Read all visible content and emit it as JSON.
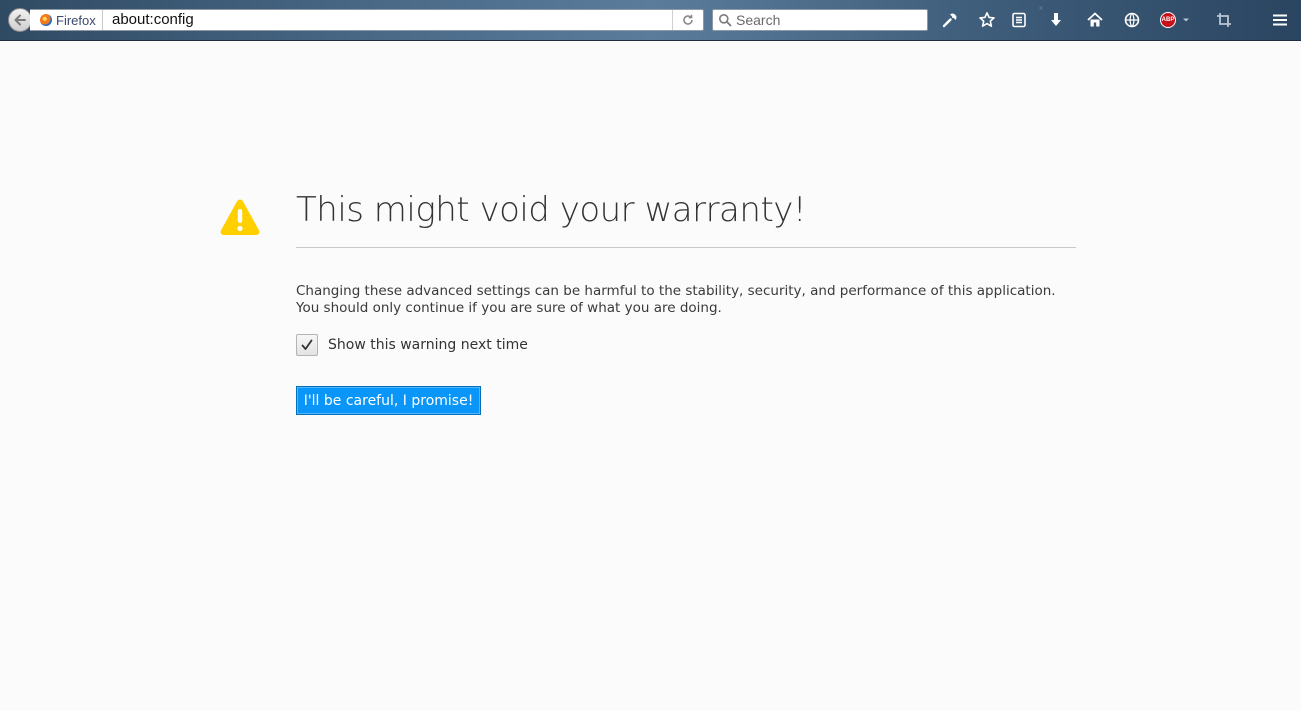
{
  "toolbar": {
    "identity_label": "Firefox",
    "url": "about:config",
    "search_placeholder": "Search",
    "abp_label": "ABP"
  },
  "warning": {
    "title": "This might void your warranty!",
    "line1": "Changing these advanced settings can be harmful to the stability, security, and performance of this application.",
    "line2": "You should only continue if you are sure of what you are doing.",
    "checkbox_label": "Show this warning next time",
    "checkbox_checked": true,
    "button_label": "I'll be careful, I promise!"
  },
  "colors": {
    "accent_button": "#0996f8",
    "warning_yellow": "#ffcf00",
    "page_background": "#fbfbfb"
  },
  "icons": [
    "back-arrow-icon",
    "firefox-logo-icon",
    "reload-icon",
    "search-icon",
    "tools-icon",
    "bookmark-star-icon",
    "reading-list-icon",
    "download-icon",
    "home-icon",
    "globe-icon",
    "adblock-icon",
    "screenshot-icon",
    "menu-icon",
    "warning-icon",
    "checkmark-icon"
  ]
}
